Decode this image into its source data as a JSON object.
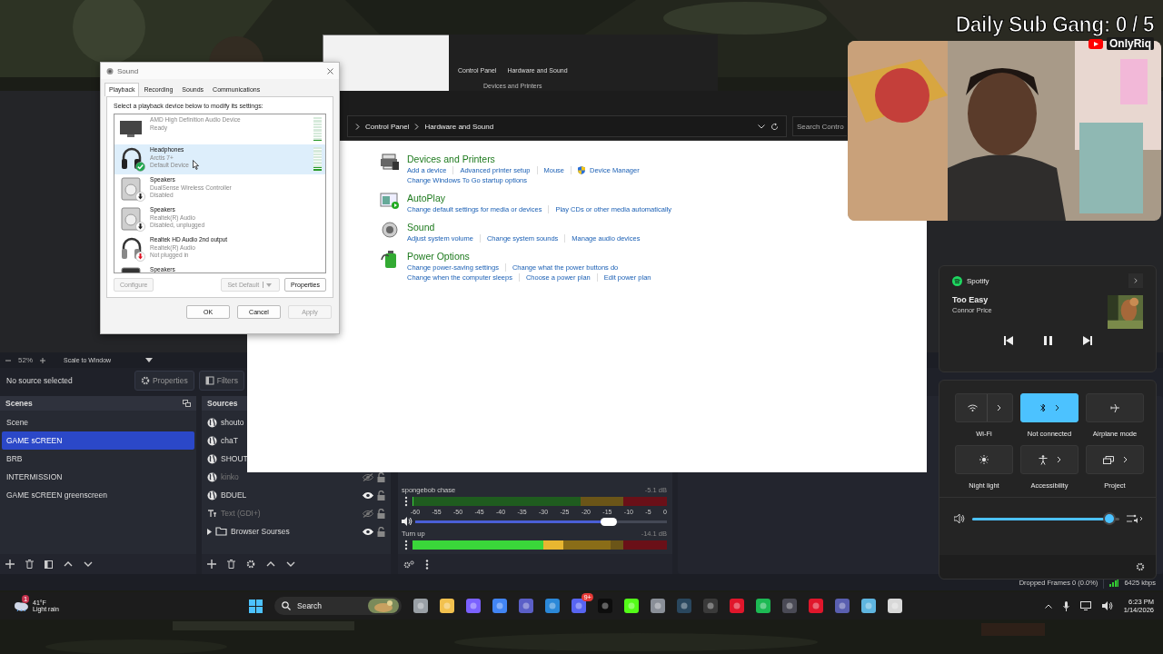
{
  "overlay": {
    "title": "Daily Sub Gang: 0 / 5",
    "channel": "OnlyRiq"
  },
  "thumbnail": {
    "path": [
      "Control Panel",
      "Hardware and Sound"
    ],
    "heading": "Devices and Printers"
  },
  "obs": {
    "zoom": "52%",
    "scale": "Scale to Window",
    "selection": "No source selected",
    "buttons": [
      "Properties",
      "Filters"
    ],
    "scenes": {
      "title": "Scenes",
      "items": [
        {
          "name": "Scene",
          "selected": false
        },
        {
          "name": "GAME sCREEN",
          "selected": true
        },
        {
          "name": "BRB",
          "selected": false
        },
        {
          "name": "INTERMISSION",
          "selected": false
        },
        {
          "name": "GAME sCREEN greenscreen",
          "selected": false
        }
      ]
    },
    "sources": {
      "title": "Sources",
      "items": [
        {
          "name": "shouto",
          "kind": "browser"
        },
        {
          "name": "chaT",
          "kind": "browser"
        },
        {
          "name": "SHOUT",
          "kind": "browser"
        },
        {
          "name": "kinko",
          "kind": "browser",
          "visible": false
        },
        {
          "name": "BDUEL",
          "kind": "browser",
          "visible": true
        },
        {
          "name": "Text (GDI+)",
          "kind": "text",
          "visible": false
        },
        {
          "name": "Browser Sourses",
          "kind": "group",
          "visible": true
        }
      ]
    },
    "mixer": {
      "scale": [
        "-60",
        "-55",
        "-50",
        "-45",
        "-40",
        "-35",
        "-30",
        "-25",
        "-20",
        "-15",
        "-10",
        "-5",
        "0"
      ],
      "channels": [
        {
          "name": "spongebob chase",
          "reading": "-5.1 dB",
          "meter": {
            "level": 0
          },
          "volume": {
            "level": 0.77
          }
        },
        {
          "name": "Turn up",
          "reading": "-14.1 dB",
          "meter": {
            "level": 0.78
          }
        }
      ]
    },
    "status": {
      "dropped": "Dropped Frames 0 (0.0%)",
      "bitrate": "6425 kbps"
    }
  },
  "control_panel": {
    "breadcrumb": [
      "Control Panel",
      "Hardware and Sound"
    ],
    "search": {
      "placeholder": "Search Contro"
    },
    "categories": [
      {
        "title": "Devices and Printers",
        "kind": "devices",
        "lines": [
          [
            {
              "text": "Add a device",
              "kind": "plain"
            },
            {
              "text": "Advanced printer setup",
              "kind": "plain"
            },
            {
              "text": "Mouse",
              "kind": "plain"
            },
            {
              "text": "Device Manager",
              "kind": "shield"
            }
          ],
          [
            {
              "text": "Change Windows To Go startup options",
              "kind": "plain"
            }
          ]
        ]
      },
      {
        "title": "AutoPlay",
        "kind": "autoplay",
        "lines": [
          [
            {
              "text": "Change default settings for media or devices",
              "kind": "plain"
            },
            {
              "text": "Play CDs or other media automatically",
              "kind": "plain"
            }
          ]
        ]
      },
      {
        "title": "Sound",
        "kind": "sound",
        "lines": [
          [
            {
              "text": "Adjust system volume",
              "kind": "plain"
            },
            {
              "text": "Change system sounds",
              "kind": "plain"
            },
            {
              "text": "Manage audio devices",
              "kind": "plain"
            }
          ]
        ]
      },
      {
        "title": "Power Options",
        "kind": "power",
        "lines": [
          [
            {
              "text": "Change power-saving settings",
              "kind": "plain"
            },
            {
              "text": "Change what the power buttons do",
              "kind": "plain"
            }
          ],
          [
            {
              "text": "Change when the computer sleeps",
              "kind": "plain"
            },
            {
              "text": "Choose a power plan",
              "kind": "plain"
            },
            {
              "text": "Edit power plan",
              "kind": "plain"
            }
          ]
        ]
      }
    ]
  },
  "sound_dialog": {
    "title": "Sound",
    "tabs": [
      {
        "label": "Playback",
        "selected": true
      },
      {
        "label": "Recording",
        "selected": false
      },
      {
        "label": "Sounds",
        "selected": false
      },
      {
        "label": "Communications",
        "selected": false
      }
    ],
    "prompt": "Select a playback device below to modify its settings:",
    "devices": [
      {
        "description": "AMD High Definition Audio Device",
        "status": "Ready",
        "kind": "monitor",
        "selected": false,
        "level": 0
      },
      {
        "name": "Headphones",
        "description": "Arctis 7+",
        "status": "Default Device",
        "kind": "headphones",
        "selected": true,
        "level": 0.15
      },
      {
        "name": "Speakers",
        "description": "DualSense Wireless Controller",
        "status": "Disabled",
        "kind": "disabledspeaker",
        "selected": false
      },
      {
        "name": "Speakers",
        "description": "Realtek(R) Audio",
        "status": "Disabled, unplugged",
        "kind": "disabledspeaker",
        "selected": false
      },
      {
        "name": "Realtek HD Audio 2nd output",
        "description": "Realtek(R) Audio",
        "status": "Not plugged in",
        "kind": "unpluggedheadphones",
        "selected": false
      },
      {
        "name": "Speakers",
        "kind": "speaker",
        "selected": false
      }
    ],
    "device_buttons": [
      {
        "label": "Configure",
        "disabled": true
      },
      {
        "label": "Set Default",
        "disabled": true
      },
      {
        "label": "Properties",
        "disabled": false
      }
    ],
    "buttons": [
      {
        "label": "OK",
        "disabled": false
      },
      {
        "label": "Cancel",
        "disabled": false
      },
      {
        "label": "Apply",
        "disabled": true
      }
    ]
  },
  "quick_settings": {
    "media": {
      "app": "Spotify",
      "title": "Too Easy",
      "artist": "Connor Price",
      "playing": true
    },
    "tiles": [
      {
        "label": "Wi-Fi",
        "kind": "wifi",
        "on": false,
        "chevron": true
      },
      {
        "label": "Not connected",
        "kind": "bluetooth",
        "on": true,
        "chevron": true
      },
      {
        "label": "Airplane mode",
        "kind": "airplane",
        "on": false,
        "chevron": false
      },
      {
        "label": "Night light",
        "kind": "night",
        "on": false,
        "chevron": false
      },
      {
        "label": "Accessibility",
        "kind": "accessibility",
        "on": false,
        "chevron": true
      },
      {
        "label": "Project",
        "kind": "project",
        "on": false,
        "chevron": true
      }
    ],
    "volume": {
      "level": 0.93
    }
  },
  "taskbar": {
    "weather": {
      "temp": "41°F",
      "condition": "Light rain",
      "badge": "1"
    },
    "search": {
      "placeholder": "Search"
    },
    "apps": [
      {
        "kind": "taskview"
      },
      {
        "kind": "explorer"
      },
      {
        "kind": "copilot"
      },
      {
        "kind": "chrome"
      },
      {
        "kind": "teams"
      },
      {
        "kind": "store"
      },
      {
        "kind": "discord",
        "badge": "9+"
      },
      {
        "kind": "x"
      },
      {
        "kind": "kick"
      },
      {
        "kind": "settings"
      },
      {
        "kind": "steam"
      },
      {
        "kind": "obs"
      },
      {
        "kind": "opera"
      },
      {
        "kind": "spotify"
      },
      {
        "kind": "game"
      },
      {
        "kind": "opera"
      },
      {
        "kind": "terminal"
      },
      {
        "kind": "remote"
      },
      {
        "kind": "mouse"
      }
    ],
    "time": "6:23 PM",
    "date": "1/14/2026"
  }
}
